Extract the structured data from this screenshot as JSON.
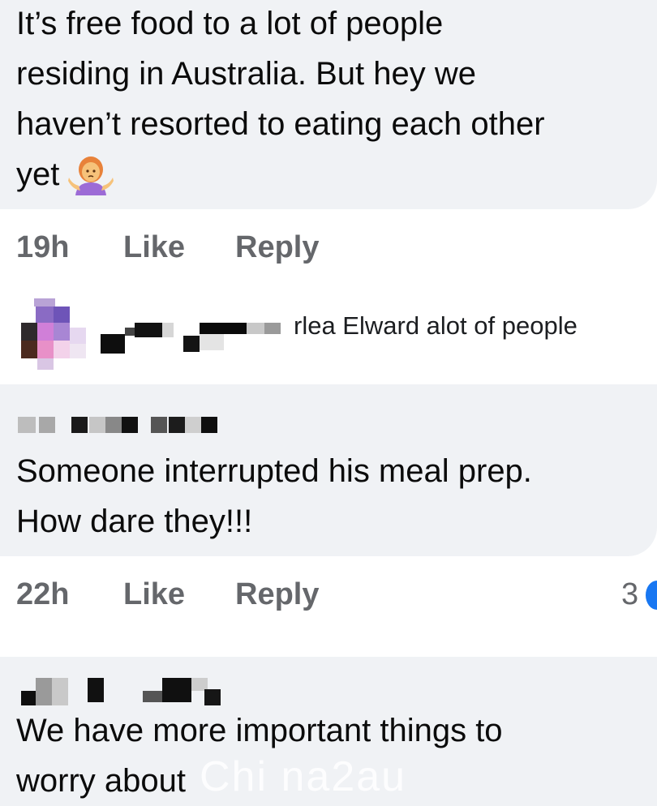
{
  "comment1": {
    "text_lines": [
      "It’s free food to a lot of people",
      "residing in Australia. But hey we",
      "haven’t resorted to eating each other",
      "yet"
    ],
    "emoji": "woman-shrugging-emoji",
    "time": "19h",
    "like_label": "Like",
    "reply_label": "Reply"
  },
  "reply_preview": {
    "text": "rlea Elward alot of people"
  },
  "comment2": {
    "text_lines": [
      "Someone interrupted his meal prep.",
      "How dare they!!!"
    ],
    "time": "22h",
    "like_label": "Like",
    "reply_label": "Reply",
    "reaction_count": "3"
  },
  "comment3": {
    "text_lines": [
      "We have more important things to",
      "worry about"
    ]
  },
  "watermark": "Chi na2au",
  "colors": {
    "bubble": "#f0f2f5",
    "meta": "#65676b",
    "reaction_blue": "#1877f2"
  }
}
